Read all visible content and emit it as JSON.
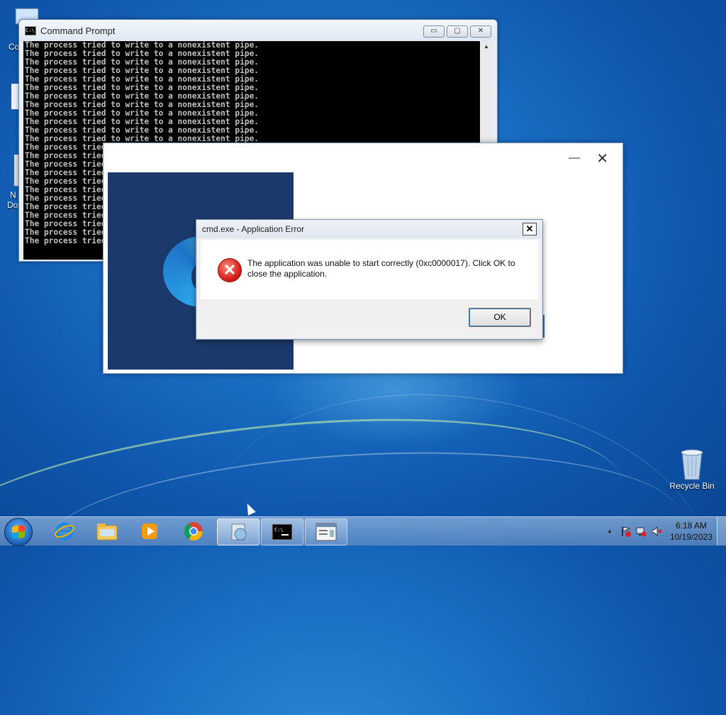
{
  "desktop": {
    "partial_labels": [
      "Co",
      "N",
      "Do"
    ],
    "recycle_bin_label": "Recycle Bin"
  },
  "cmd_window": {
    "title": "Command Prompt",
    "line_text": "The process tried to write to a nonexistent pipe.",
    "line_count": 24,
    "buttons": {
      "minimize": "▭",
      "maximize": "▢",
      "close": "✕"
    }
  },
  "setup_window": {
    "minimize": "—",
    "close": "✕"
  },
  "error_dialog": {
    "title": "cmd.exe - Application Error",
    "message": "The application was unable to start correctly (0xc0000017). Click OK to close the application.",
    "ok_label": "OK",
    "close_glyph": "✕",
    "icon": "error-icon"
  },
  "taskbar": {
    "items": [
      "start-orb",
      "internet-explorer",
      "windows-explorer",
      "media-player",
      "chrome",
      "setup-app",
      "command-prompt",
      "notepad-window"
    ],
    "clock_time": "6:18 AM",
    "clock_date": "10/19/2023",
    "tray_up_arrow": "▲"
  }
}
